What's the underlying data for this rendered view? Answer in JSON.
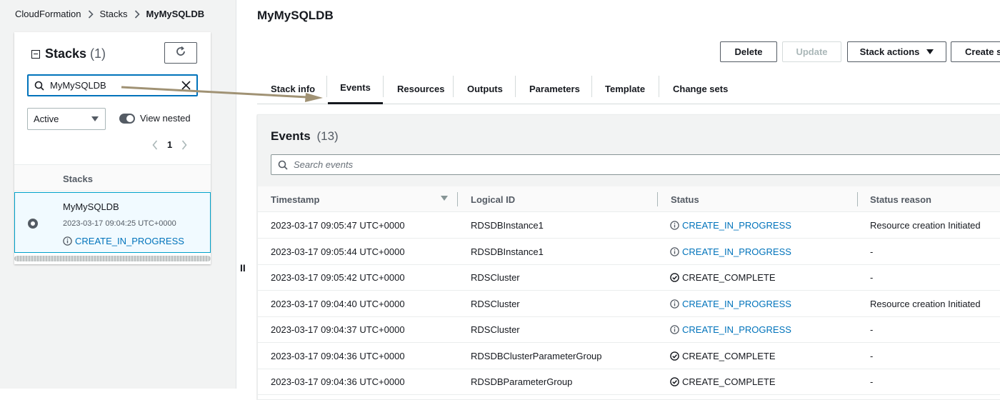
{
  "breadcrumb": [
    {
      "label": "CloudFormation"
    },
    {
      "label": "Stacks"
    },
    {
      "label": "MyMySQLDB"
    }
  ],
  "stacks_panel": {
    "title": "Stacks",
    "count": "(1)",
    "search_value": "MyMySQLDB",
    "filter_value": "Active",
    "toggle_label": "View nested",
    "toggle_on": true,
    "page": "1",
    "column_header": "Stacks",
    "stack": {
      "name": "MyMySQLDB",
      "created": "2023-03-17 09:04:25 UTC+0000",
      "status": "CREATE_IN_PROGRESS"
    }
  },
  "main": {
    "title": "MyMySQLDB",
    "buttons": {
      "delete": "Delete",
      "update": "Update",
      "stack_actions": "Stack actions",
      "create": "Create stack"
    },
    "tabs": [
      {
        "label": "Stack info"
      },
      {
        "label": "Events",
        "active": true
      },
      {
        "label": "Resources"
      },
      {
        "label": "Outputs"
      },
      {
        "label": "Parameters"
      },
      {
        "label": "Template"
      },
      {
        "label": "Change sets"
      }
    ],
    "events": {
      "title": "Events",
      "count": "(13)",
      "search_placeholder": "Search events",
      "columns": [
        "Timestamp",
        "Logical ID",
        "Status",
        "Status reason"
      ],
      "rows": [
        {
          "timestamp": "2023-03-17 09:05:47 UTC+0000",
          "logical_id": "RDSDBInstance1",
          "status": "CREATE_IN_PROGRESS",
          "status_kind": "progress",
          "reason": "Resource creation Initiated"
        },
        {
          "timestamp": "2023-03-17 09:05:44 UTC+0000",
          "logical_id": "RDSDBInstance1",
          "status": "CREATE_IN_PROGRESS",
          "status_kind": "progress",
          "reason": "-"
        },
        {
          "timestamp": "2023-03-17 09:05:42 UTC+0000",
          "logical_id": "RDSCluster",
          "status": "CREATE_COMPLETE",
          "status_kind": "complete",
          "reason": "-"
        },
        {
          "timestamp": "2023-03-17 09:04:40 UTC+0000",
          "logical_id": "RDSCluster",
          "status": "CREATE_IN_PROGRESS",
          "status_kind": "progress",
          "reason": "Resource creation Initiated"
        },
        {
          "timestamp": "2023-03-17 09:04:37 UTC+0000",
          "logical_id": "RDSCluster",
          "status": "CREATE_IN_PROGRESS",
          "status_kind": "progress",
          "reason": "-"
        },
        {
          "timestamp": "2023-03-17 09:04:36 UTC+0000",
          "logical_id": "RDSDBClusterParameterGroup",
          "status": "CREATE_COMPLETE",
          "status_kind": "complete",
          "reason": "-"
        },
        {
          "timestamp": "2023-03-17 09:04:36 UTC+0000",
          "logical_id": "RDSDBParameterGroup",
          "status": "CREATE_COMPLETE",
          "status_kind": "complete",
          "reason": "-"
        }
      ]
    }
  },
  "icons": {
    "breadcrumb_separator": "chevron-right-icon",
    "refresh": "refresh-icon",
    "search": "search-icon",
    "clear": "close-icon",
    "info": "info-icon",
    "complete": "check-circle-icon"
  },
  "colors": {
    "link_blue": "#0073bb",
    "panel_bg": "#f2f3f3",
    "selected_row_bg": "#f1faff",
    "selected_row_border": "#00a1c9",
    "annotation_arrow": "#a09274"
  }
}
